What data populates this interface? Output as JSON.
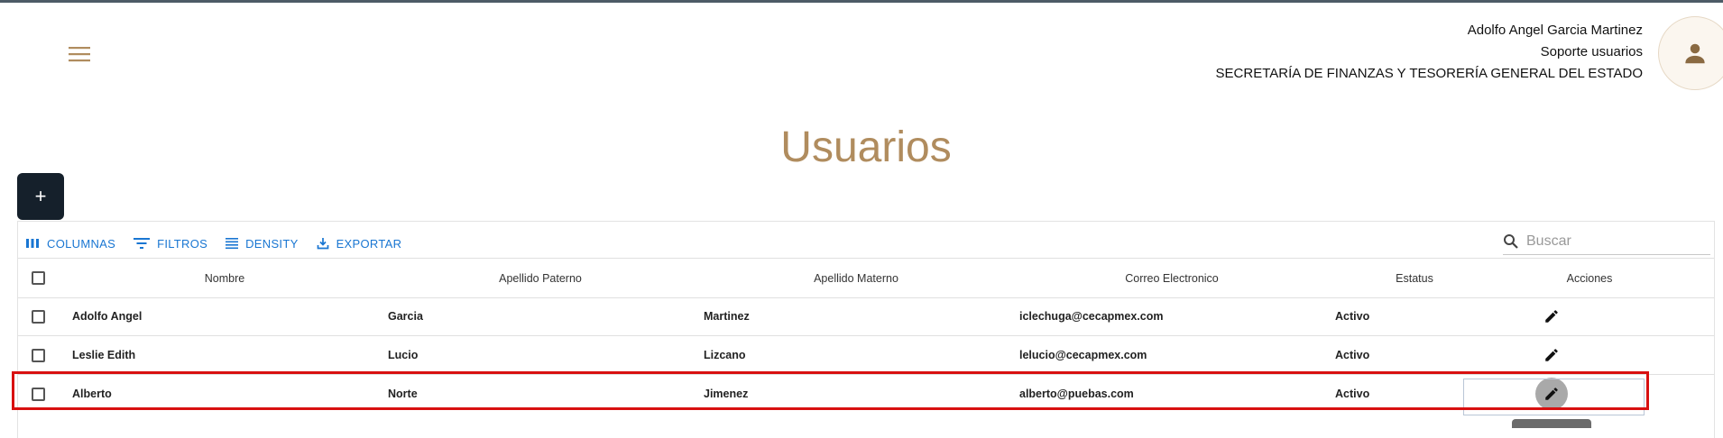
{
  "header": {
    "user_name": "Adolfo Angel Garcia Martinez",
    "role": "Soporte usuarios",
    "department": "SECRETARÍA DE FINANZAS Y TESORERÍA GENERAL DEL ESTADO",
    "menu_icon": "hamburger-menu-icon",
    "avatar_icon": "person-icon"
  },
  "page": {
    "title": "Usuarios",
    "add_label": "+"
  },
  "colors": {
    "accent": "#b08c5e",
    "link": "#1976d2",
    "add_button": "#15202b",
    "highlight": "#d81010"
  },
  "toolbar": {
    "columns": "COLUMNAS",
    "filters": "FILTROS",
    "density": "DENSITY",
    "export": "EXPORTAR",
    "search_placeholder": "Buscar"
  },
  "table": {
    "columns": [
      "Nombre",
      "Apellido Paterno",
      "Apellido Materno",
      "Correo Electronico",
      "Estatus",
      "Acciones"
    ],
    "rows": [
      [
        "Adolfo Angel",
        "Garcia",
        "Martinez",
        "iclechuga@cecapmex.com",
        "Activo"
      ],
      [
        "Leslie Edith",
        "Lucio",
        "Lizcano",
        "lelucio@cecapmex.com",
        "Activo"
      ],
      [
        "Alberto",
        "Norte",
        "Jimenez",
        "alberto@puebas.com",
        "Activo"
      ]
    ]
  }
}
